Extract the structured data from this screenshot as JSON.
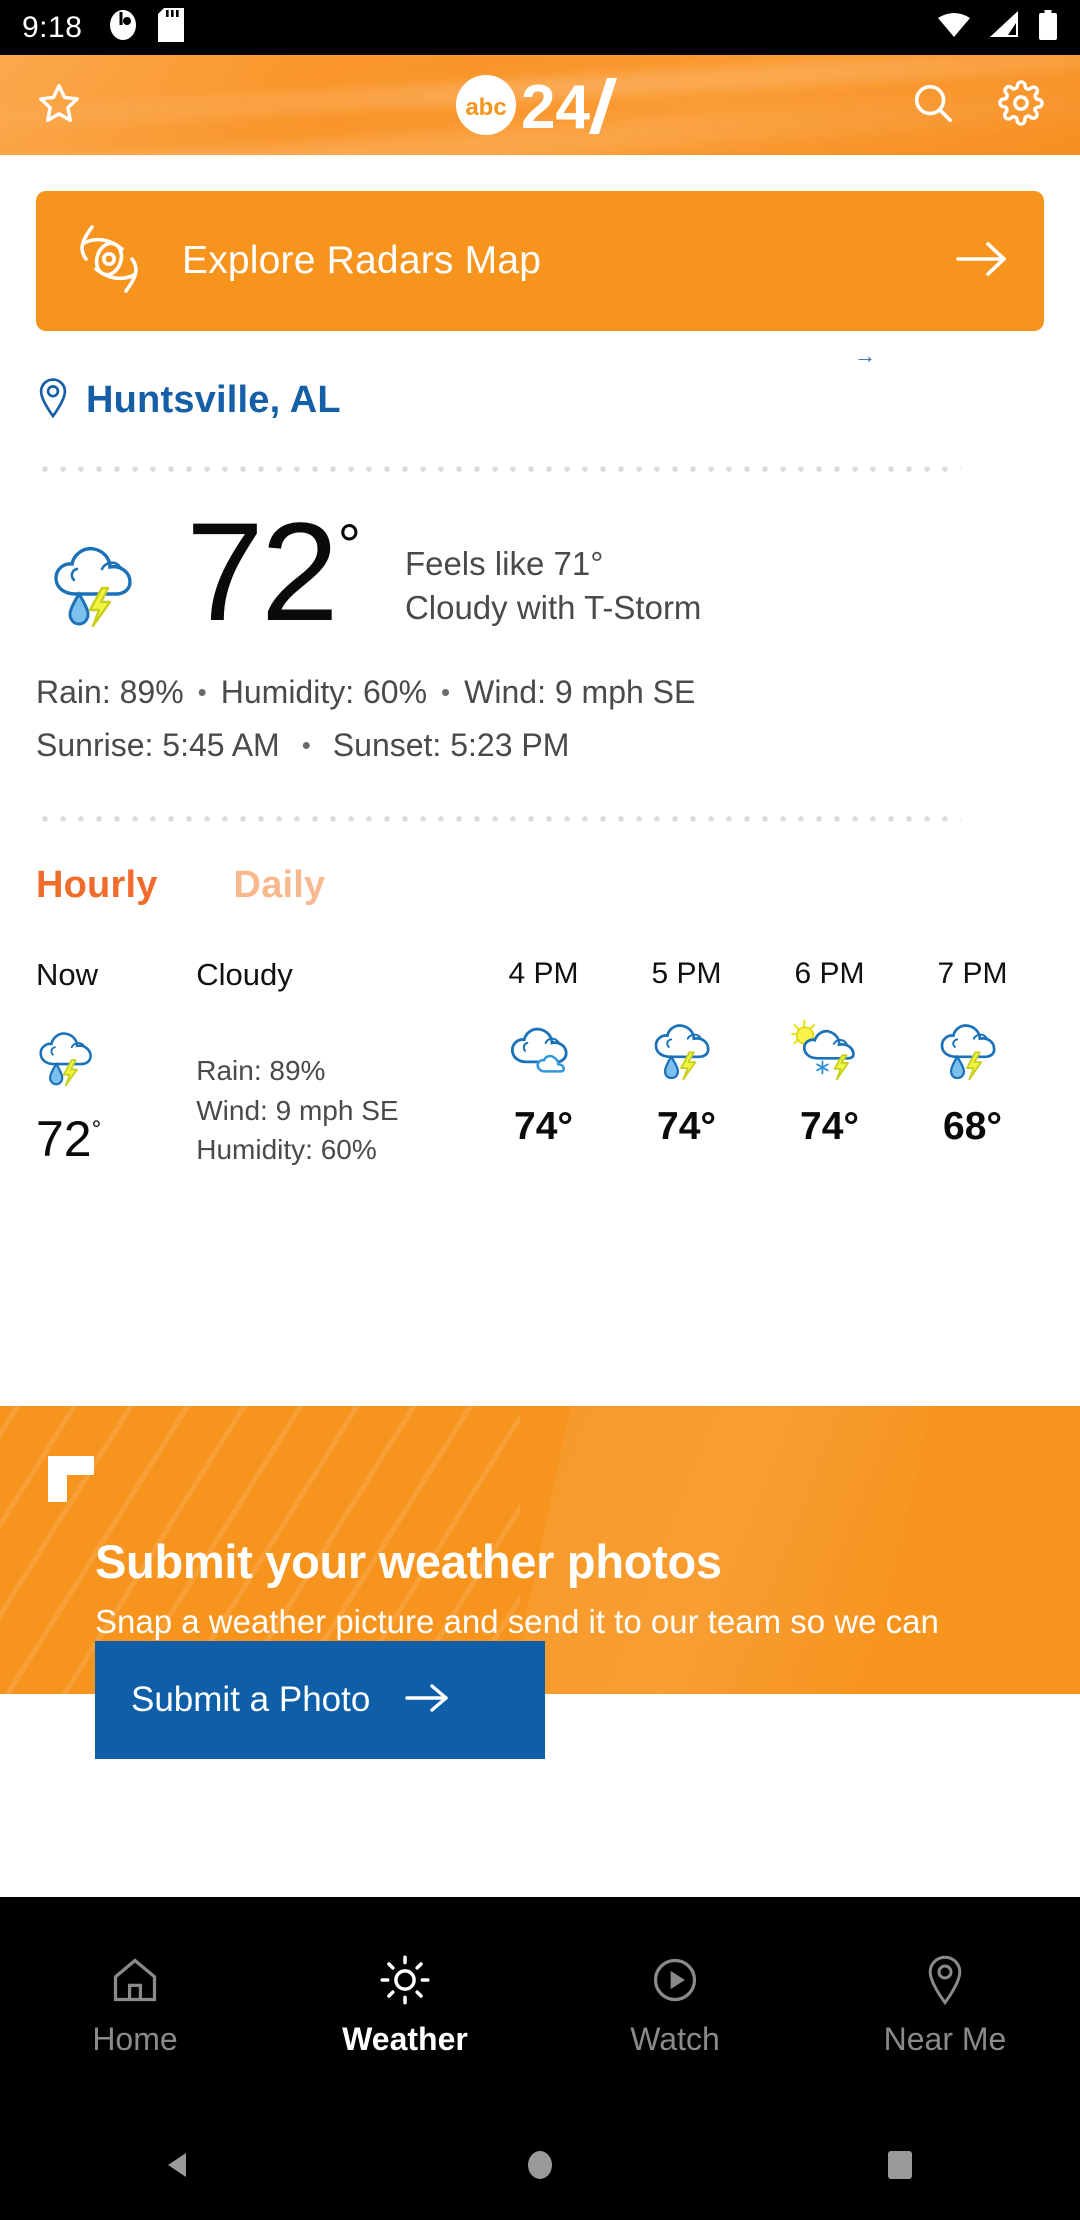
{
  "status_bar": {
    "time": "9:18",
    "left_icons": [
      "screen-record-icon",
      "sd-card-icon"
    ],
    "right_icons": [
      "wifi-icon",
      "cellular-signal-icon",
      "battery-icon"
    ]
  },
  "header": {
    "favorite_icon": "star-icon",
    "logo_text": "abc24",
    "logo_abc": "abc",
    "logo_num": "24",
    "search_icon": "search-icon",
    "settings_icon": "gear-icon"
  },
  "radar_banner": {
    "label": "Explore Radars Map",
    "icon": "hurricane-radar-icon",
    "arrow": "arrow-right-icon",
    "bg_color": "#f7941e"
  },
  "location": {
    "name": "Huntsville, AL",
    "pin_icon": "location-pin-icon",
    "color": "#155fa6",
    "mini_arrow": "→"
  },
  "current": {
    "icon": "cloud-rain-thunder-icon",
    "temp": "72",
    "degree": "°",
    "feels_like": "Feels like 71°",
    "condition": "Cloudy with T-Storm",
    "metrics_line1": [
      "Rain: 89%",
      "Humidity: 60%",
      "Wind: 9 mph SE"
    ],
    "metrics_line2": [
      "Sunrise: 5:45 AM",
      "Sunset: 5:23 PM"
    ],
    "separator": "•"
  },
  "tabs": {
    "hourly": "Hourly",
    "daily": "Daily",
    "active": "Hourly",
    "active_color": "#ef6c2a",
    "inactive_color": "#f9b98f"
  },
  "hourly_now": {
    "time_label": "Now",
    "condition": "Cloudy",
    "icon": "cloud-rain-thunder-icon",
    "temp": "72",
    "degree": "°",
    "rain": "Rain: 89%",
    "wind": "Wind: 9 mph SE",
    "humidity": "Humidity: 60%"
  },
  "hourly_forecast": [
    {
      "time": "4 PM",
      "icon": "cloudy-icon",
      "temp": "74°"
    },
    {
      "time": "5 PM",
      "icon": "cloud-rain-thunder-icon",
      "temp": "74°"
    },
    {
      "time": "6 PM",
      "icon": "sun-cloud-snow-thunder-icon",
      "temp": "74°"
    },
    {
      "time": "7 PM",
      "icon": "cloud-rain-thunder-icon",
      "temp": "68°"
    }
  ],
  "promo": {
    "title": "Submit your weather photos",
    "subtitle": "Snap a weather picture and send it to our team so we can show it on air.",
    "button_label": "Submit a Photo",
    "button_arrow": "arrow-right-icon",
    "bg_color": "#f7941e",
    "button_color": "#0f5fa8"
  },
  "bottom_nav": {
    "items": [
      {
        "label": "Home",
        "icon": "home-icon",
        "active": false
      },
      {
        "label": "Weather",
        "icon": "sun-icon",
        "active": true
      },
      {
        "label": "Watch",
        "icon": "play-circle-icon",
        "active": false
      },
      {
        "label": "Near Me",
        "icon": "location-pin-icon",
        "active": false
      }
    ]
  },
  "android_nav": {
    "back": "back-triangle-icon",
    "home": "home-circle-icon",
    "recents": "recents-square-icon"
  }
}
